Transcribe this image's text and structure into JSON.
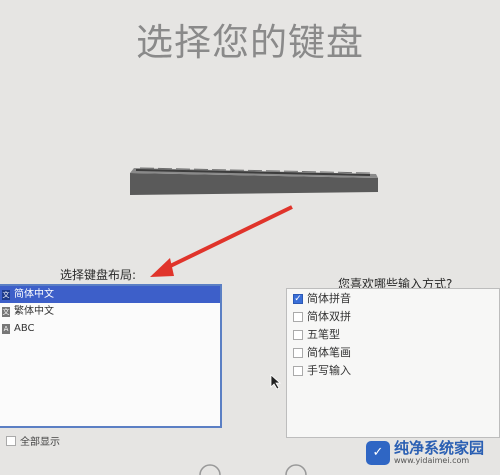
{
  "title": "选择您的键盘",
  "layout_section": {
    "label": "选择键盘布局:",
    "items": [
      {
        "label": "简体中文",
        "selected": true
      },
      {
        "label": "繁体中文",
        "selected": false
      },
      {
        "label": "ABC",
        "selected": false
      }
    ],
    "show_all_label": "全部显示"
  },
  "method_section": {
    "label": "您喜欢哪些输入方式?",
    "items": [
      {
        "label": "简体拼音",
        "checked": true
      },
      {
        "label": "简体双拼",
        "checked": false
      },
      {
        "label": "五笔型",
        "checked": false
      },
      {
        "label": "简体笔画",
        "checked": false
      },
      {
        "label": "手写输入",
        "checked": false
      }
    ]
  },
  "watermark": {
    "name": "纯净系统家园",
    "url": "www.yidaimei.com"
  },
  "colors": {
    "selection": "#3d5fc9",
    "arrow": "#e0342b",
    "checkbox": "#3a6fd8"
  }
}
